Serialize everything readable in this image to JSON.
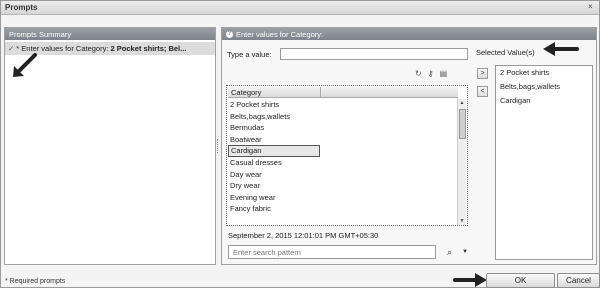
{
  "window": {
    "title": "Prompts",
    "close_glyph": "×"
  },
  "left_panel": {
    "header": "Prompts Summary",
    "summary_item": {
      "prefix": "* Enter values for Category: ",
      "value": "2 Pocket shirts; Bel..."
    }
  },
  "right_panel": {
    "header": "Enter values for Category:",
    "type_label": "Type a value:",
    "type_value": "",
    "list": {
      "column_header": "Category",
      "items": [
        "2 Pocket shirts",
        "Belts,bags,wallets",
        "Bermudas",
        "Boatwear",
        "Cardigan",
        "Casual dresses",
        "Day wear",
        "Dry wear",
        "Evening wear",
        "Fancy fabric"
      ],
      "selected_index": 4
    },
    "timestamp": "September 2, 2015 12:01:01 PM GMT+05:30",
    "search_placeholder": "Enter search pattern",
    "add_button": ">",
    "remove_button": "<",
    "selected_label": "Selected Value(s)",
    "selected_values": [
      "2 Pocket shirts",
      "Belts,bags,wallets",
      "Cardigan"
    ]
  },
  "footer": {
    "required_note": "* Required prompts",
    "ok_label": "OK",
    "cancel_label": "Cancel"
  },
  "icons": [
    "close-icon",
    "check-icon",
    "prompt-icon",
    "refresh-icon",
    "key-icon",
    "database-icon",
    "binoculars-icon",
    "chevron-down-icon",
    "scroll-up-icon",
    "scroll-down-icon"
  ]
}
